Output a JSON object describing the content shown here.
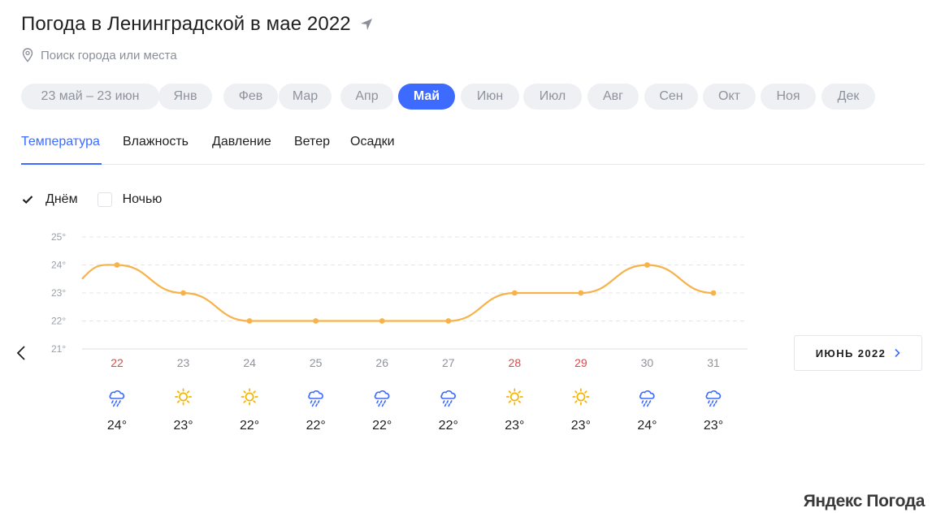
{
  "page": {
    "title": "Погода в Ленинградской в мае 2022",
    "search_placeholder": "Поиск города или места"
  },
  "months": [
    {
      "label": "23 май – 23 июн",
      "active": false
    },
    {
      "label": "Янв",
      "active": false
    },
    {
      "label": "Фев",
      "active": false
    },
    {
      "label": "Мар",
      "active": false
    },
    {
      "label": "Апр",
      "active": false
    },
    {
      "label": "Май",
      "active": true
    },
    {
      "label": "Июн",
      "active": false
    },
    {
      "label": "Июл",
      "active": false
    },
    {
      "label": "Авг",
      "active": false
    },
    {
      "label": "Сен",
      "active": false
    },
    {
      "label": "Окт",
      "active": false
    },
    {
      "label": "Ноя",
      "active": false
    },
    {
      "label": "Дек",
      "active": false
    }
  ],
  "tabs": [
    {
      "label": "Температура",
      "active": true
    },
    {
      "label": "Влажность",
      "active": false
    },
    {
      "label": "Давление",
      "active": false
    },
    {
      "label": "Ветер",
      "active": false
    },
    {
      "label": "Осадки",
      "active": false
    }
  ],
  "toggles": [
    {
      "label": "Днём",
      "checked": true
    },
    {
      "label": "Ночью",
      "checked": false
    }
  ],
  "next_month": {
    "label": "ИЮНЬ 2022"
  },
  "brand": "Яндекс Погода",
  "colors": {
    "accent": "#3d6aff",
    "line": "#f7b34a",
    "weekend": "#e64545",
    "weekday": "#8e939c",
    "rain_icon": "#3d6aff",
    "sun_icon": "#f5b400"
  },
  "chart_data": {
    "type": "line",
    "y_ticks": [
      "25°",
      "24°",
      "23°",
      "22°",
      "21°"
    ],
    "ylim": [
      21,
      25
    ],
    "grid": true,
    "x": [
      22,
      23,
      24,
      25,
      26,
      27,
      28,
      29,
      30,
      31
    ],
    "weekend": [
      true,
      false,
      false,
      false,
      false,
      false,
      true,
      true,
      false,
      false
    ],
    "values": [
      24,
      23,
      22,
      22,
      22,
      22,
      23,
      23,
      24,
      23
    ],
    "temps": [
      "24°",
      "23°",
      "22°",
      "22°",
      "22°",
      "22°",
      "23°",
      "23°",
      "24°",
      "23°"
    ],
    "icons": [
      "rain-icon",
      "sun-icon",
      "sun-icon",
      "rain-icon",
      "rain-icon",
      "rain-icon",
      "sun-icon",
      "sun-icon",
      "rain-icon",
      "rain-icon"
    ]
  }
}
